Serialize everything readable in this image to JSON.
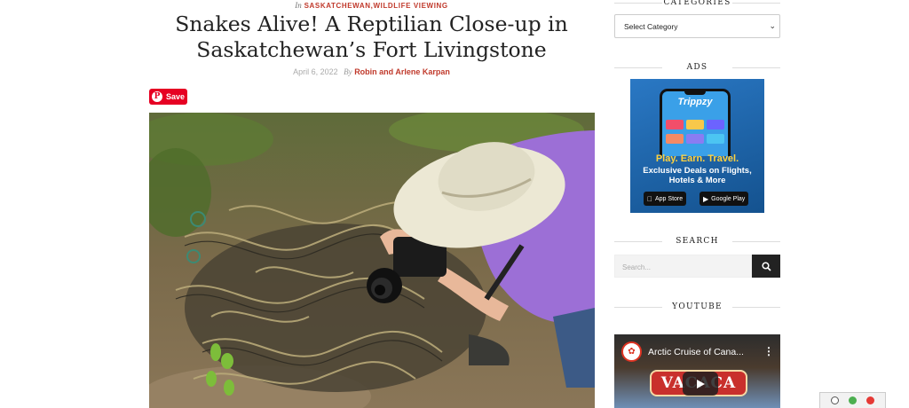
{
  "article": {
    "category_prefix": "In",
    "categories": [
      "SASKATCHEWAN",
      "WILDLIFE VIEWING"
    ],
    "category_separator": ",",
    "title": "Snakes Alive! A Reptilian Close-up in Saskatchewan’s Fort Livingstone",
    "date": "April 6, 2022",
    "by": "By",
    "author": "Robin and Arlene Karpan",
    "pin_label": "Save"
  },
  "sidebar": {
    "categories_title": "CATEGORIES",
    "category_select_value": "Select Category",
    "ads_title": "ADS",
    "ad": {
      "brand": "Trippzy",
      "tagline": "Play. Earn. Travel.",
      "line1": "Exclusive Deals on Flights,",
      "line2": "Hotels & More",
      "appstore": "App Store",
      "googleplay": "Google Play"
    },
    "search_title": "SEARCH",
    "search_placeholder": "Search...",
    "youtube_title": "YOUTUBE",
    "video": {
      "title": "Arctic Cruise of Cana...",
      "sign_text": "VACACA"
    }
  },
  "colors": {
    "accent": "#c0392b",
    "pinterest": "#e60023"
  }
}
